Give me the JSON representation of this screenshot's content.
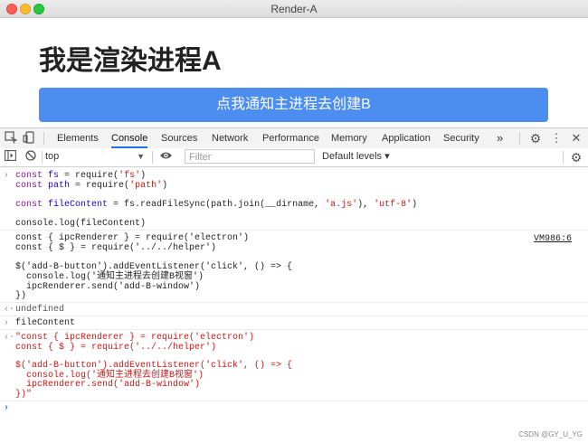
{
  "window": {
    "title": "Render-A"
  },
  "page": {
    "heading": "我是渲染进程A",
    "button_label": "点我通知主进程去创建B"
  },
  "devtools": {
    "tabs": [
      "Elements",
      "Console",
      "Sources",
      "Network",
      "Performance",
      "Memory",
      "Application",
      "Security"
    ],
    "active_tab": "Console",
    "more_tabs_label": "»",
    "context": "top",
    "filter_placeholder": "Filter",
    "levels_label": "Default levels ▾"
  },
  "console": {
    "input1": {
      "l1": {
        "kw": "const",
        "var": "fs",
        "eq": " = require(",
        "s": "'fs'",
        "end": ")"
      },
      "l2": {
        "kw": "const",
        "var": "path",
        "eq": " = require(",
        "s": "'path'",
        "end": ")"
      },
      "l3": {
        "kw": "const",
        "var": "fileContent",
        "eq": " = fs.readFileSync(path.join(__dirname, ",
        "s1": "'a.js'",
        "mid": "), ",
        "s2": "'utf-8'",
        "end": ")"
      },
      "l4": "console.log(fileContent)"
    },
    "log": {
      "lines": [
        "const { ipcRenderer } = require('electron')",
        "const { $ } = require('../../helper')",
        "",
        "$('add-B-button').addEventListener('click', () => {",
        "  console.log('通知主进程去创建B视窗')",
        "  ipcRenderer.send('add-B-window')",
        "})"
      ],
      "source": "VM986:6"
    },
    "result1": "undefined",
    "input2": "fileContent",
    "result2": [
      "\"const { ipcRenderer } = require('electron')",
      "const { $ } = require('../../helper')",
      "",
      "$('add-B-button').addEventListener('click', () => {",
      "  console.log('通知主进程去创建B视窗')",
      "  ipcRenderer.send('add-B-window')",
      "})\""
    ]
  },
  "watermark": "CSDN @GY_U_YG"
}
